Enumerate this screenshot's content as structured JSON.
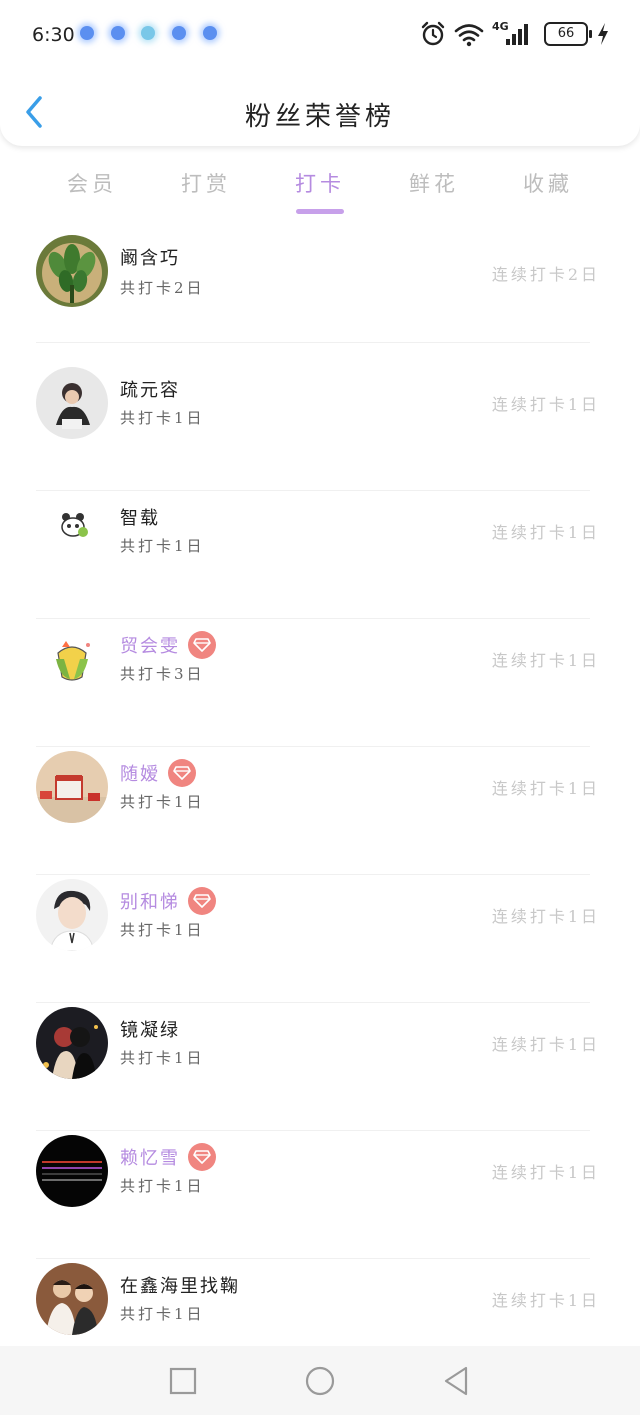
{
  "status_bar": {
    "time": "6:30",
    "network": "4G",
    "battery": "66",
    "icons": [
      "app-notification-icon",
      "alarm-icon",
      "wifi-icon",
      "signal-icon",
      "battery-icon",
      "charging-icon"
    ]
  },
  "header": {
    "title": "粉丝荣誉榜",
    "back_icon": "chevron-left-icon",
    "accent_color": "#3a9ee8"
  },
  "tabs": [
    {
      "label": "会员",
      "active": false
    },
    {
      "label": "打赏",
      "active": false
    },
    {
      "label": "打卡",
      "active": true
    },
    {
      "label": "鲜花",
      "active": false
    },
    {
      "label": "收藏",
      "active": false
    }
  ],
  "colors": {
    "active_tab": "#b58be0",
    "vip_name": "#b58be0",
    "badge": "#f08580",
    "inactive": "#bdbdbd",
    "streak": "#c8c8c8"
  },
  "fans": [
    {
      "name": "阚含巧",
      "vip": false,
      "total": "共打卡2日",
      "streak": "连续打卡2日",
      "avatar": "plant-photo-avatar"
    },
    {
      "name": "疏元容",
      "vip": false,
      "total": "共打卡1日",
      "streak": "连续打卡1日",
      "avatar": "child-photo-avatar"
    },
    {
      "name": "智载",
      "vip": false,
      "total": "共打卡1日",
      "streak": "连续打卡1日",
      "avatar": "panda-cartoon-avatar"
    },
    {
      "name": "贸会雯",
      "vip": true,
      "total": "共打卡3日",
      "streak": "连续打卡1日",
      "avatar": "corn-cartoon-avatar"
    },
    {
      "name": "随嫒",
      "vip": true,
      "total": "共打卡1日",
      "streak": "连续打卡1日",
      "avatar": "cake-photo-avatar"
    },
    {
      "name": "别和悌",
      "vip": true,
      "total": "共打卡1日",
      "streak": "连续打卡1日",
      "avatar": "boy-photo-avatar"
    },
    {
      "name": "镜凝绿",
      "vip": false,
      "total": "共打卡1日",
      "streak": "连续打卡1日",
      "avatar": "couple-night-avatar"
    },
    {
      "name": "赖忆雪",
      "vip": true,
      "total": "共打卡1日",
      "streak": "连续打卡1日",
      "avatar": "dark-text-avatar"
    },
    {
      "name": "在鑫海里找鞠",
      "vip": false,
      "total": "共打卡1日",
      "streak": "连续打卡1日",
      "avatar": "people-photo-avatar"
    }
  ],
  "system_nav": [
    "recent-apps-icon",
    "home-icon",
    "back-icon"
  ]
}
